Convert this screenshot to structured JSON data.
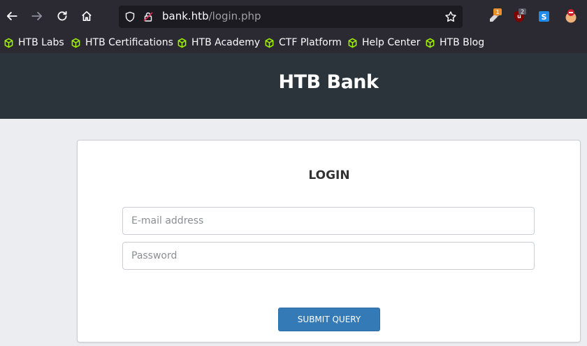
{
  "browser": {
    "url_host": "bank.htb",
    "url_path": "/login.php",
    "bookmarks": [
      {
        "label": "HTB Labs"
      },
      {
        "label": "HTB Certifications"
      },
      {
        "label": "HTB Academy"
      },
      {
        "label": "CTF Platform"
      },
      {
        "label": "Help Center"
      },
      {
        "label": "HTB Blog"
      }
    ],
    "extensions": [
      {
        "name": "extension-1-icon",
        "badge": "1"
      },
      {
        "name": "ublock-icon",
        "badge": "2"
      },
      {
        "name": "extension-s-icon",
        "badge": ""
      },
      {
        "name": "extension-4-icon",
        "badge": ""
      }
    ],
    "colors": {
      "toolbar": "#2b2a33",
      "bookmark_icon": "#9fef00"
    }
  },
  "site": {
    "title": "HTB Bank",
    "header_color": "#2b343b"
  },
  "login": {
    "title": "LOGIN",
    "email_placeholder": "E-mail address",
    "password_placeholder": "Password",
    "submit_label": "SUBMIT QUERY",
    "button_color": "#337ab7"
  }
}
